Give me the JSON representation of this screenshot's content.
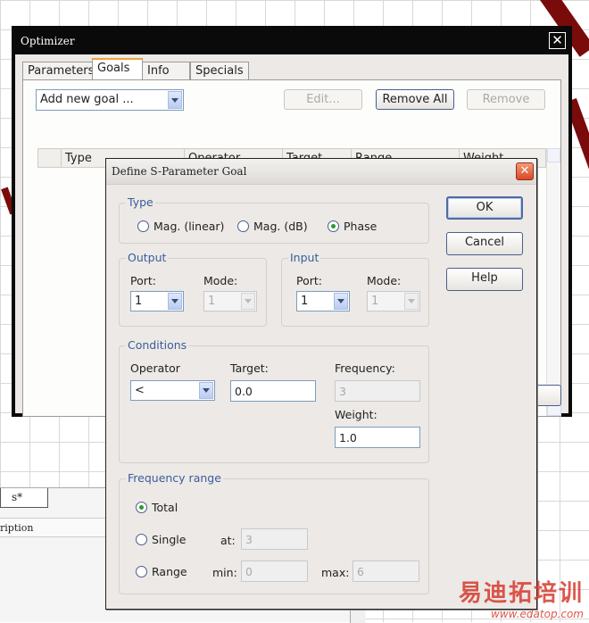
{
  "optimizer": {
    "title": "Optimizer",
    "close_glyph": "✕",
    "tabs": [
      "Parameters",
      "Goals",
      "Info",
      "Specials"
    ],
    "active_tab": "Goals",
    "add_goal_value": "Add new goal ...",
    "buttons": {
      "edit": "Edit...",
      "remove_all": "Remove All",
      "remove": "Remove"
    },
    "columns": [
      "",
      "Type",
      "Operator",
      "Target",
      "Range",
      "Weight"
    ]
  },
  "dialog": {
    "title": "Define S-Parameter Goal",
    "close_glyph": "✕",
    "type": {
      "legend": "Type",
      "options": [
        "Mag. (linear)",
        "Mag. (dB)",
        "Phase"
      ],
      "selected": "Phase"
    },
    "output": {
      "legend": "Output",
      "port_label": "Port:",
      "port_value": "1",
      "mode_label": "Mode:",
      "mode_value": "1"
    },
    "input": {
      "legend": "Input",
      "port_label": "Port:",
      "port_value": "1",
      "mode_label": "Mode:",
      "mode_value": "1"
    },
    "conditions": {
      "legend": "Conditions",
      "operator_label": "Operator",
      "operator_value": "<",
      "target_label": "Target:",
      "target_value": "0.0",
      "frequency_label": "Frequency:",
      "frequency_value": "3",
      "weight_label": "Weight:",
      "weight_value": "1.0"
    },
    "frequency_range": {
      "legend": "Frequency range",
      "total_label": "Total",
      "single_label": "Single",
      "at_label": "at:",
      "at_value": "3",
      "range_label": "Range",
      "min_label": "min:",
      "min_value": "0",
      "max_label": "max:",
      "max_value": "6",
      "selected": "Total"
    },
    "buttons": {
      "ok": "OK",
      "cancel": "Cancel",
      "help": "Help"
    }
  },
  "background": {
    "tab_label": "s*",
    "column_fragment": "ription"
  },
  "watermark": {
    "brand": "易迪拓培训",
    "url": "www.edatop.com"
  }
}
